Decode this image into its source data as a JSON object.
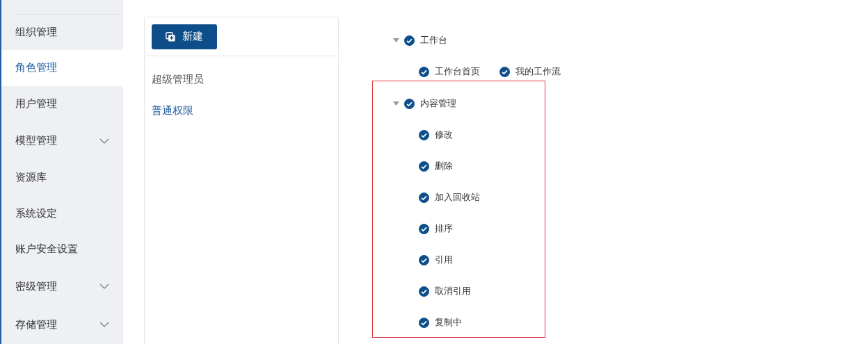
{
  "sidebar": {
    "items": [
      {
        "label": "组织管理",
        "selected": false,
        "expandable": false
      },
      {
        "label": "角色管理",
        "selected": true,
        "expandable": false
      },
      {
        "label": "用户管理",
        "selected": false,
        "expandable": false
      },
      {
        "label": "模型管理",
        "selected": false,
        "expandable": true
      },
      {
        "label": "资源库",
        "selected": false,
        "expandable": false
      },
      {
        "label": "系统设定",
        "selected": false,
        "expandable": false
      },
      {
        "label": "账户安全设置",
        "selected": false,
        "expandable": false
      },
      {
        "label": "密级管理",
        "selected": false,
        "expandable": true
      },
      {
        "label": "存储管理",
        "selected": false,
        "expandable": true
      }
    ]
  },
  "roles": {
    "new_button": "新建",
    "items": [
      {
        "label": "超级管理员",
        "selected": false
      },
      {
        "label": "普通权限",
        "selected": true
      }
    ]
  },
  "permissions": [
    {
      "label": "工作台",
      "checked": true,
      "expanded": true,
      "highlighted": false,
      "kind": "inline",
      "children": [
        {
          "label": "工作台首页",
          "checked": true
        },
        {
          "label": "我的工作流",
          "checked": true
        }
      ]
    },
    {
      "label": "内容管理",
      "checked": true,
      "expanded": true,
      "highlighted": true,
      "kind": "stacked",
      "children": [
        {
          "label": "修改",
          "checked": true
        },
        {
          "label": "删除",
          "checked": true
        },
        {
          "label": "加入回收站",
          "checked": true
        },
        {
          "label": "排序",
          "checked": true
        },
        {
          "label": "引用",
          "checked": true
        },
        {
          "label": "取消引用",
          "checked": true
        },
        {
          "label": "复制中",
          "checked": true
        }
      ]
    }
  ]
}
